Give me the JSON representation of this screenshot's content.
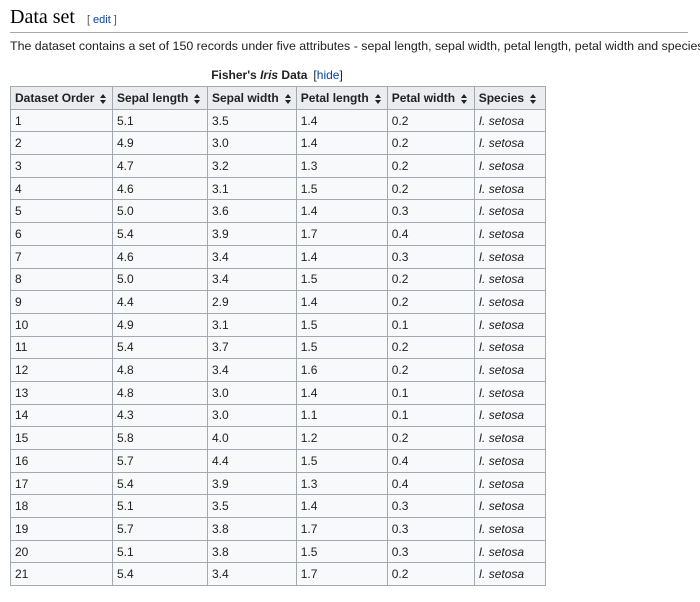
{
  "section": {
    "title": "Data set",
    "edit_open": "[",
    "edit_label": "edit",
    "edit_close": "]"
  },
  "intro_text": "The dataset contains a set of 150 records under five attributes - sepal length, sepal width, petal length, petal width and species.",
  "table": {
    "caption_prefix": "Fisher's ",
    "caption_italic": "Iris",
    "caption_suffix": " Data",
    "toggle_open": "[",
    "toggle_label": "hide",
    "toggle_close": "]",
    "headers": [
      "Dataset Order",
      "Sepal length",
      "Sepal width",
      "Petal length",
      "Petal width",
      "Species"
    ],
    "sort_icon": "sort-icon",
    "rows": [
      [
        "1",
        "5.1",
        "3.5",
        "1.4",
        "0.2",
        "I. setosa"
      ],
      [
        "2",
        "4.9",
        "3.0",
        "1.4",
        "0.2",
        "I. setosa"
      ],
      [
        "3",
        "4.7",
        "3.2",
        "1.3",
        "0.2",
        "I. setosa"
      ],
      [
        "4",
        "4.6",
        "3.1",
        "1.5",
        "0.2",
        "I. setosa"
      ],
      [
        "5",
        "5.0",
        "3.6",
        "1.4",
        "0.3",
        "I. setosa"
      ],
      [
        "6",
        "5.4",
        "3.9",
        "1.7",
        "0.4",
        "I. setosa"
      ],
      [
        "7",
        "4.6",
        "3.4",
        "1.4",
        "0.3",
        "I. setosa"
      ],
      [
        "8",
        "5.0",
        "3.4",
        "1.5",
        "0.2",
        "I. setosa"
      ],
      [
        "9",
        "4.4",
        "2.9",
        "1.4",
        "0.2",
        "I. setosa"
      ],
      [
        "10",
        "4.9",
        "3.1",
        "1.5",
        "0.1",
        "I. setosa"
      ],
      [
        "11",
        "5.4",
        "3.7",
        "1.5",
        "0.2",
        "I. setosa"
      ],
      [
        "12",
        "4.8",
        "3.4",
        "1.6",
        "0.2",
        "I. setosa"
      ],
      [
        "13",
        "4.8",
        "3.0",
        "1.4",
        "0.1",
        "I. setosa"
      ],
      [
        "14",
        "4.3",
        "3.0",
        "1.1",
        "0.1",
        "I. setosa"
      ],
      [
        "15",
        "5.8",
        "4.0",
        "1.2",
        "0.2",
        "I. setosa"
      ],
      [
        "16",
        "5.7",
        "4.4",
        "1.5",
        "0.4",
        "I. setosa"
      ],
      [
        "17",
        "5.4",
        "3.9",
        "1.3",
        "0.4",
        "I. setosa"
      ],
      [
        "18",
        "5.1",
        "3.5",
        "1.4",
        "0.3",
        "I. setosa"
      ],
      [
        "19",
        "5.7",
        "3.8",
        "1.7",
        "0.3",
        "I. setosa"
      ],
      [
        "20",
        "5.1",
        "3.8",
        "1.5",
        "0.3",
        "I. setosa"
      ],
      [
        "21",
        "5.4",
        "3.4",
        "1.7",
        "0.2",
        "I. setosa"
      ]
    ]
  },
  "colors": {
    "link": "#0645ad",
    "header_bg": "#eaecf0",
    "cell_bg": "#f8f9fa",
    "border": "#a2a9b1"
  }
}
